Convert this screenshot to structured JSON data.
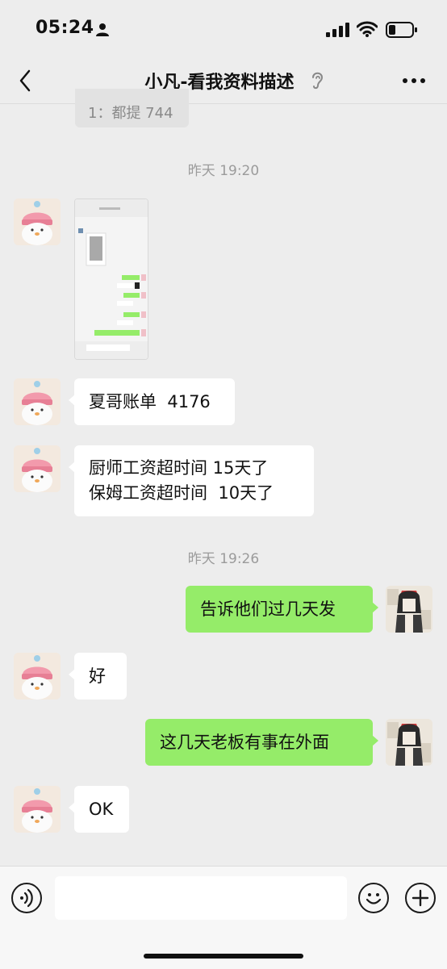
{
  "status": {
    "time": "05:24"
  },
  "header": {
    "title": "小凡-看我资料描述"
  },
  "partial_message": {
    "text": "1：都提 744"
  },
  "messages": [
    {
      "kind": "time",
      "text": "昨天 19:20"
    },
    {
      "kind": "image",
      "sender": "contact"
    },
    {
      "kind": "text",
      "sender": "contact",
      "text": "夏哥账单  4176"
    },
    {
      "kind": "text",
      "sender": "contact",
      "text": "厨师工资超时间 15天了\n保姆工资超时间  10天了"
    },
    {
      "kind": "time",
      "text": "昨天 19:26"
    },
    {
      "kind": "text",
      "sender": "me",
      "text": "告诉他们过几天发"
    },
    {
      "kind": "text",
      "sender": "contact",
      "text": "好"
    },
    {
      "kind": "text",
      "sender": "me",
      "text": "这几天老板有事在外面"
    },
    {
      "kind": "text",
      "sender": "contact",
      "text": "OK"
    }
  ],
  "input": {
    "value": "",
    "placeholder": ""
  },
  "colors": {
    "outgoing_bubble": "#95ec69",
    "incoming_bubble": "#ffffff",
    "background": "#ededed"
  }
}
